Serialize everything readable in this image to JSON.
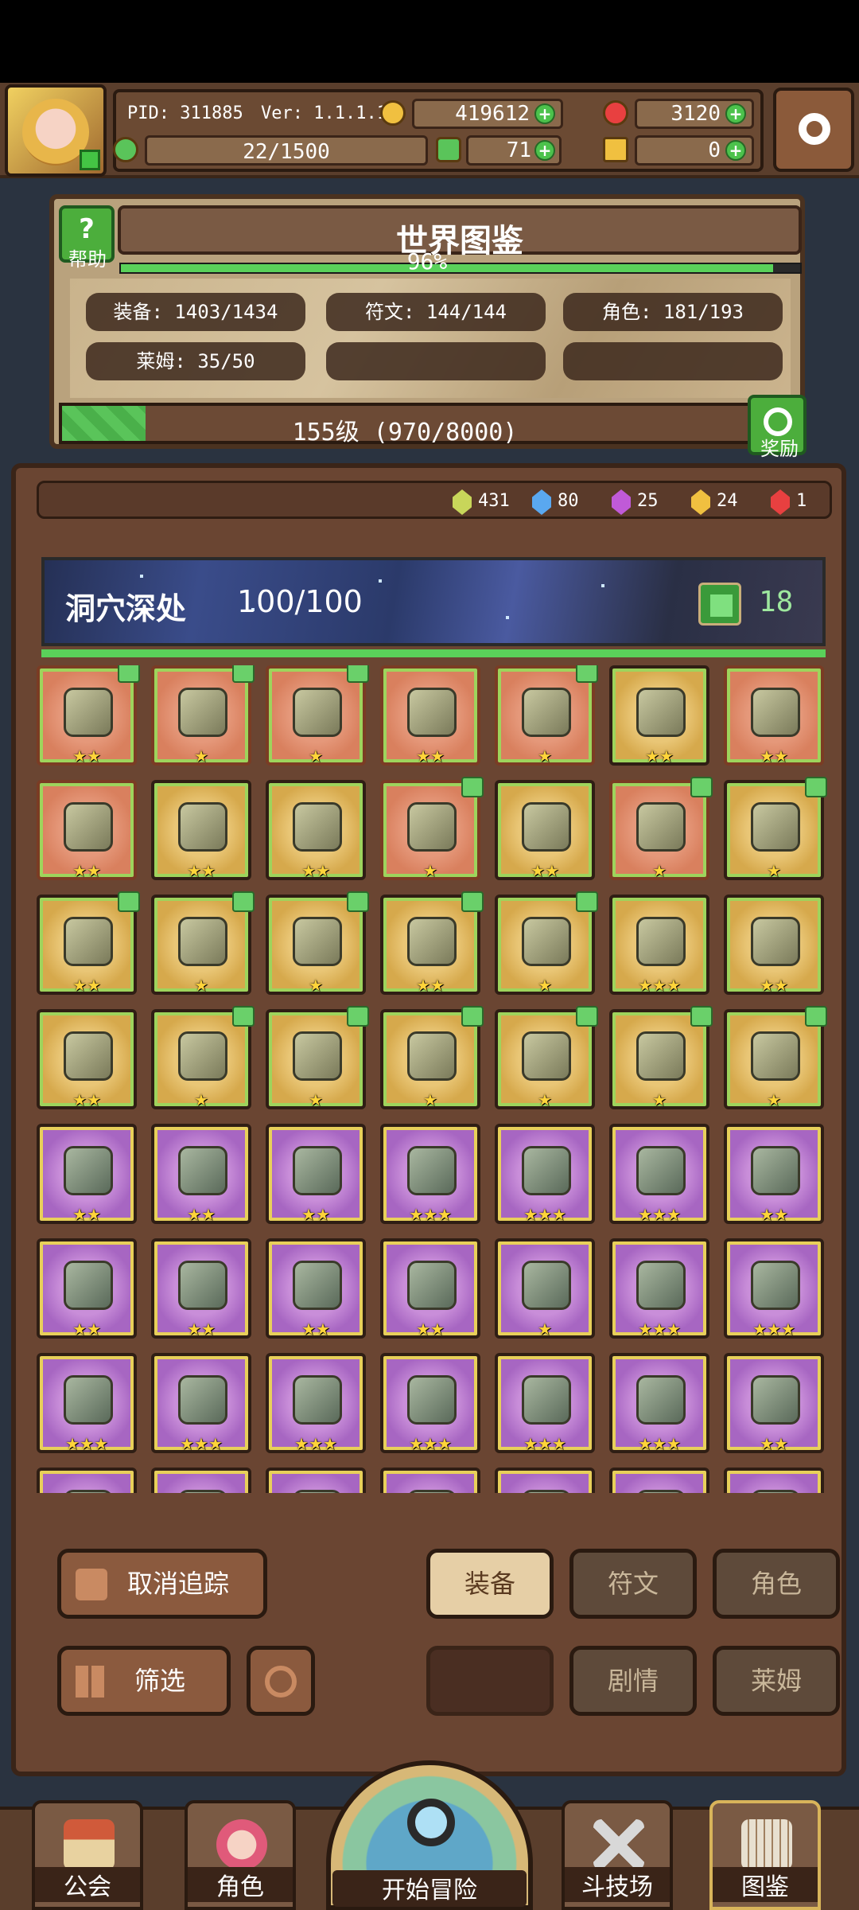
{
  "topbar": {
    "pid": "PID: 311885",
    "version": "Ver: 1.1.1.14",
    "gold": "419612",
    "gems": "3120",
    "stamina": "22/1500",
    "clover": "71",
    "key": "0"
  },
  "world": {
    "title": "世界图鉴",
    "help_label": "帮助",
    "percent": "96%",
    "percent_value": 0.96,
    "stats": {
      "equipment": "装备: 1403/1434",
      "runes": "符文: 144/144",
      "characters": "角色: 181/193",
      "slimes": "莱姆: 35/50"
    },
    "level_text": "155级 (970/8000)",
    "level_fraction": 0.12125,
    "reward_label": "奖励"
  },
  "gems": [
    {
      "count": "431",
      "color": "#c8d65a"
    },
    {
      "count": "80",
      "color": "#5aa8f0"
    },
    {
      "count": "25",
      "color": "#c05ad8"
    },
    {
      "count": "24",
      "color": "#f0c040"
    },
    {
      "count": "1",
      "color": "#e84040"
    }
  ],
  "zone": {
    "name": "洞穴深处",
    "progress": "100/100",
    "likes": "18"
  },
  "items": [
    {
      "name": "item-chest-armor",
      "rarity": "orange",
      "stars": "★★",
      "liked": true
    },
    {
      "name": "item-mace",
      "rarity": "orange",
      "stars": "★",
      "liked": true
    },
    {
      "name": "item-gauntlet",
      "rarity": "orange",
      "stars": "★",
      "liked": true
    },
    {
      "name": "item-belt",
      "rarity": "orange",
      "stars": "★★",
      "liked": false
    },
    {
      "name": "item-sword",
      "rarity": "orange",
      "stars": "★",
      "liked": true
    },
    {
      "name": "item-helmet",
      "rarity": "gold",
      "stars": "★★",
      "liked": false
    },
    {
      "name": "item-body-armor",
      "rarity": "orange",
      "stars": "★★",
      "liked": false
    },
    {
      "name": "item-bow",
      "rarity": "orange",
      "stars": "★★",
      "liked": false
    },
    {
      "name": "item-amulet",
      "rarity": "gold",
      "stars": "★★",
      "liked": false
    },
    {
      "name": "item-ring",
      "rarity": "gold",
      "stars": "★★",
      "liked": false
    },
    {
      "name": "item-staff",
      "rarity": "orange",
      "stars": "★",
      "liked": true
    },
    {
      "name": "item-hat",
      "rarity": "gold",
      "stars": "★★",
      "liked": false
    },
    {
      "name": "item-necklace",
      "rarity": "orange",
      "stars": "★",
      "liked": true
    },
    {
      "name": "item-shield",
      "rarity": "gold",
      "stars": "★",
      "liked": true
    },
    {
      "name": "item-goggles",
      "rarity": "gold",
      "stars": "★★",
      "liked": true
    },
    {
      "name": "item-crystal-armor",
      "rarity": "gold",
      "stars": "★",
      "liked": true
    },
    {
      "name": "item-demon-helm",
      "rarity": "gold",
      "stars": "★",
      "liked": true
    },
    {
      "name": "item-crab-armor",
      "rarity": "gold",
      "stars": "★★",
      "liked": true
    },
    {
      "name": "item-sun-scroll",
      "rarity": "gold",
      "stars": "★",
      "liked": true
    },
    {
      "name": "item-horned-helm",
      "rarity": "gold",
      "stars": "★★★",
      "liked": false
    },
    {
      "name": "item-dark-helm",
      "rarity": "gold",
      "stars": "★★",
      "liked": false
    },
    {
      "name": "item-gem-necklace",
      "rarity": "gold",
      "stars": "★★",
      "liked": false
    },
    {
      "name": "item-stone-shield",
      "rarity": "gold",
      "stars": "★",
      "liked": true
    },
    {
      "name": "item-stone-bracer",
      "rarity": "gold",
      "stars": "★",
      "liked": true
    },
    {
      "name": "item-star-charm",
      "rarity": "gold",
      "stars": "★",
      "liked": true
    },
    {
      "name": "item-shell",
      "rarity": "gold",
      "stars": "★",
      "liked": true
    },
    {
      "name": "item-ruby-pendant",
      "rarity": "gold",
      "stars": "★",
      "liked": true
    },
    {
      "name": "item-ruby-ring",
      "rarity": "gold",
      "stars": "★",
      "liked": true
    },
    {
      "name": "item-jade-sword",
      "rarity": "purple",
      "stars": "★★",
      "liked": false
    },
    {
      "name": "item-knight-armor",
      "rarity": "purple",
      "stars": "★★",
      "liked": false
    },
    {
      "name": "item-plate-armor",
      "rarity": "purple",
      "stars": "★★",
      "liked": false
    },
    {
      "name": "item-arm-guard",
      "rarity": "purple",
      "stars": "★★★",
      "liked": false
    },
    {
      "name": "item-bracelet",
      "rarity": "purple",
      "stars": "★★★",
      "liked": false
    },
    {
      "name": "item-orb",
      "rarity": "purple",
      "stars": "★★★",
      "liked": false
    },
    {
      "name": "item-royal-helm",
      "rarity": "purple",
      "stars": "★★",
      "liked": false
    },
    {
      "name": "item-visor-helm",
      "rarity": "purple",
      "stars": "★★",
      "liked": false
    },
    {
      "name": "item-gold-armor",
      "rarity": "purple",
      "stars": "★★",
      "liked": false
    },
    {
      "name": "item-gloves",
      "rarity": "purple",
      "stars": "★★",
      "liked": false
    },
    {
      "name": "item-belt-2",
      "rarity": "purple",
      "stars": "★★",
      "liked": false
    },
    {
      "name": "item-boots",
      "rarity": "purple",
      "stars": "★",
      "liked": false
    },
    {
      "name": "item-greatsword",
      "rarity": "purple",
      "stars": "★★★",
      "liked": false
    },
    {
      "name": "item-iron-helm",
      "rarity": "purple",
      "stars": "★★★",
      "liked": false
    },
    {
      "name": "item-dark-ring",
      "rarity": "purple",
      "stars": "★★★",
      "liked": false
    },
    {
      "name": "item-bracer-2",
      "rarity": "purple",
      "stars": "★★★",
      "liked": false
    },
    {
      "name": "item-collar",
      "rarity": "purple",
      "stars": "★★★",
      "liked": false
    },
    {
      "name": "item-boots-2",
      "rarity": "purple",
      "stars": "★★★",
      "liked": false
    },
    {
      "name": "item-heels",
      "rarity": "purple",
      "stars": "★★★",
      "liked": false
    },
    {
      "name": "item-gold-band",
      "rarity": "purple",
      "stars": "★★★",
      "liked": false
    },
    {
      "name": "item-boots-3",
      "rarity": "purple",
      "stars": "★★",
      "liked": false
    },
    {
      "name": "item-torch",
      "rarity": "purple",
      "stars": "",
      "liked": false
    },
    {
      "name": "item-pearl",
      "rarity": "purple",
      "stars": "",
      "liked": false
    },
    {
      "name": "item-pendant-2",
      "rarity": "purple",
      "stars": "",
      "liked": false
    },
    {
      "name": "item-potion",
      "rarity": "purple",
      "stars": "",
      "liked": false
    },
    {
      "name": "item-pendant-3",
      "rarity": "purple",
      "stars": "",
      "liked": false
    },
    {
      "name": "item-crab",
      "rarity": "purple",
      "stars": "",
      "liked": false
    },
    {
      "name": "item-pendant-4",
      "rarity": "purple",
      "stars": "",
      "liked": false
    }
  ],
  "controls": {
    "untrack": "取消追踪",
    "filter": "筛选",
    "tab_equipment": "装备",
    "tab_runes": "符文",
    "tab_characters": "角色",
    "tab_story": "剧情",
    "tab_slimes": "莱姆"
  },
  "nav": {
    "guild": "公会",
    "characters": "角色",
    "adventure": "开始冒险",
    "arena": "斗技场",
    "encyclopedia": "图鉴"
  },
  "colors": {
    "accent_green": "#5ad15a",
    "panel_brown": "#6a4532",
    "gold": "#ffd43a"
  }
}
